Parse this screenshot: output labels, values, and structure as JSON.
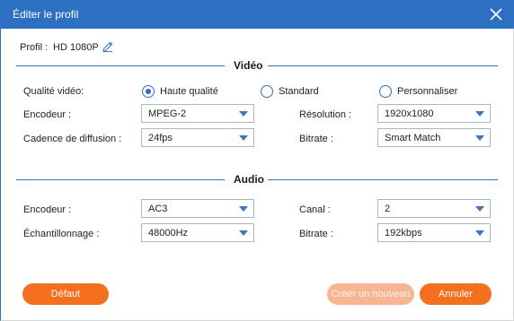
{
  "window": {
    "title": "Éditer le profil",
    "close_icon": "close-icon"
  },
  "profile": {
    "label": "Profil :",
    "value": "HD 1080P",
    "edit_icon": "pencil-icon"
  },
  "video": {
    "section_title": "Vidéo",
    "quality_label": "Qualité vidéo:",
    "quality_options": [
      "Haute qualité",
      "Standard",
      "Personnaliser"
    ],
    "quality_selected": "Haute qualité",
    "encoder_label": "Encodeur :",
    "encoder_value": "MPEG-2",
    "resolution_label": "Résolution :",
    "resolution_value": "1920x1080",
    "framerate_label": "Cadence de diffusion :",
    "framerate_value": "24fps",
    "bitrate_label": "Bitrate :",
    "bitrate_value": "Smart Match"
  },
  "audio": {
    "section_title": "Audio",
    "encoder_label": "Encodeur :",
    "encoder_value": "AC3",
    "channel_label": "Canal :",
    "channel_value": "2",
    "samplerate_label": "Échantillonnage :",
    "samplerate_value": "48000Hz",
    "bitrate_label": "Bitrate :",
    "bitrate_value": "192kbps"
  },
  "buttons": {
    "default": "Défaut",
    "create_new": "Créer un nouveau",
    "cancel": "Annuler"
  },
  "colors": {
    "accent": "#2d6fc0",
    "orange": "#f5701e",
    "orange_disabled": "#f8b594"
  }
}
